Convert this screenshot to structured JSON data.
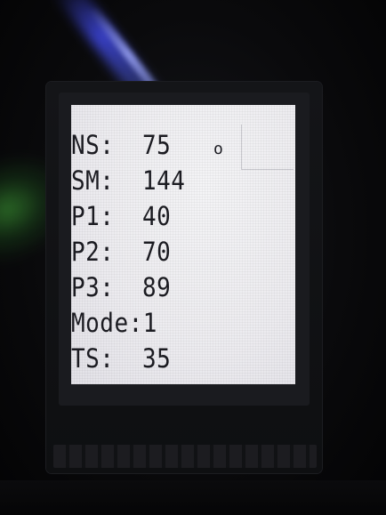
{
  "screen": {
    "rows": [
      {
        "label": "NS:",
        "value": "75",
        "unit": "o"
      },
      {
        "label": "SM:",
        "value": "144"
      },
      {
        "label": "P1:",
        "value": "40"
      },
      {
        "label": "P2:",
        "value": "70"
      },
      {
        "label": "P3:",
        "value": "89"
      },
      {
        "label": "Mode:1"
      },
      {
        "label": "TS:",
        "value": "35"
      }
    ]
  },
  "colors": {
    "screen_bg": "#ecebef",
    "text": "#1c1c22"
  }
}
